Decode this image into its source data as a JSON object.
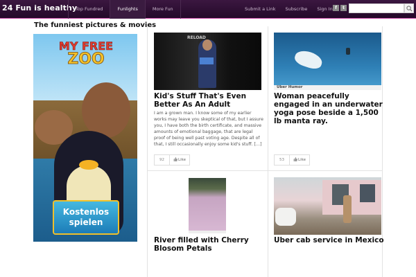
{
  "site": {
    "title": "24 Fun is healthy"
  },
  "nav": {
    "items": [
      {
        "label": "Top Fundred",
        "active": false
      },
      {
        "label": "Funlights",
        "active": true
      },
      {
        "label": "More Fun",
        "active": false
      }
    ]
  },
  "toplinks": [
    "Submit a Link",
    "Subscribe",
    "Sign In"
  ],
  "social": {
    "facebook": "f",
    "twitter": "t"
  },
  "search": {
    "placeholder": "",
    "value": ""
  },
  "section": {
    "title": "The funniest pictures & movies"
  },
  "ad": {
    "logo_line1": "MY FREE",
    "logo_line2": "ZOO",
    "cta_line1": "Kostenlos",
    "cta_line2": "spielen"
  },
  "cards": [
    {
      "title": "Kid's Stuff That's Even Better As An Adult",
      "excerpt": "I am a grown man. I know some of my earlier works may leave you skeptical of that, but I assure you, I have both the birth certificate, and massive amounts of emotional baggage, that are legal proof of being well past voting age. Despite all of that, I still occasionally enjoy some kid's stuff. […]",
      "count": "92",
      "like": "Like",
      "img_sign": "RELOAD"
    },
    {
      "title": "Woman peacefully engaged in an underwater yoga pose beside a 1,500 lb manta ray.",
      "count": "53",
      "like": "Like",
      "img_brand": "Uber Humor"
    },
    {
      "title": "River filled with Cherry Blosom Petals"
    },
    {
      "title": "Uber cab service in Mexico"
    }
  ],
  "colors": {
    "topbar": "#2c0f32",
    "accent": "#c94aa8"
  }
}
